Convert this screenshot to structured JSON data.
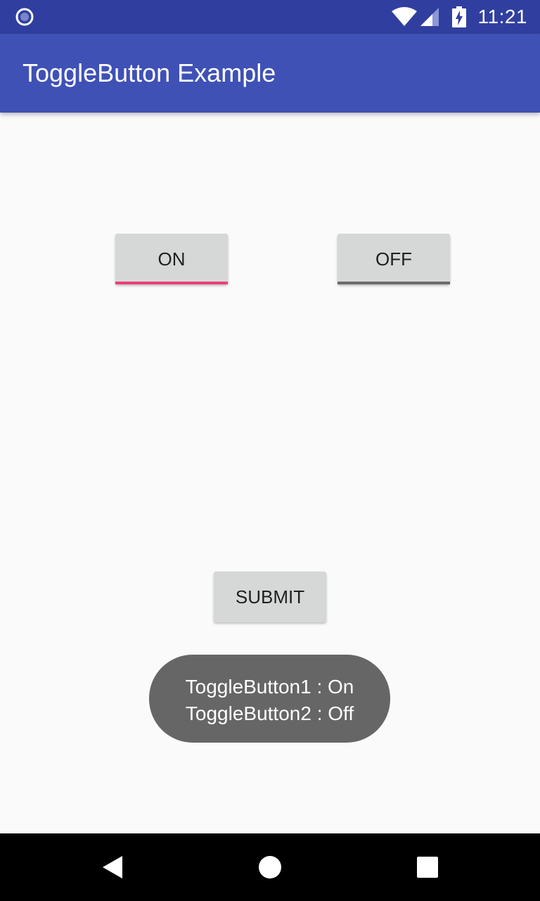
{
  "status_bar": {
    "time": "11:21",
    "icons": [
      "notification-circle-icon",
      "wifi-icon",
      "signal-icon",
      "battery-charging-icon"
    ]
  },
  "app_bar": {
    "title": "ToggleButton Example"
  },
  "toggles": [
    {
      "label": "ON",
      "checked": true,
      "indicator_color": "#ec407a"
    },
    {
      "label": "OFF",
      "checked": false,
      "indicator_color": "#6b6b6b"
    }
  ],
  "submit": {
    "label": "SUBMIT"
  },
  "toast": {
    "lines": [
      "ToggleButton1 : On",
      "ToggleButton2 : Off"
    ]
  },
  "nav_bar": {
    "icons": [
      "back-icon",
      "home-icon",
      "recents-icon"
    ]
  },
  "colors": {
    "status_bar": "#303f9f",
    "primary": "#3f51b5",
    "accent": "#ec407a",
    "background": "#fafafa",
    "button": "#d6d7d7",
    "toast": "#666666"
  }
}
